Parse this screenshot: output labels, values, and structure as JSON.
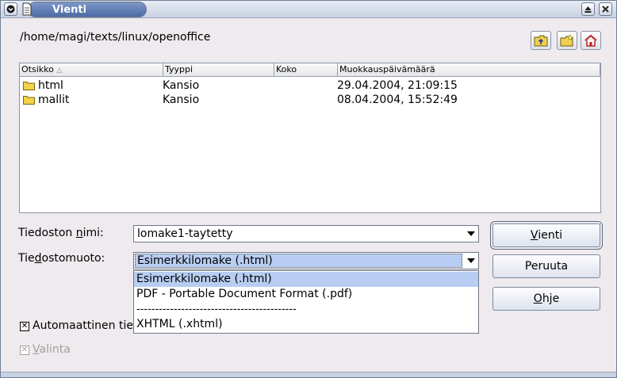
{
  "window": {
    "title": "Vienti"
  },
  "path": "/home/magi/texts/linux/openoffice",
  "file_list": {
    "columns": [
      "Otsikko",
      "Tyyppi",
      "Koko",
      "Muokkauspäivämäärä"
    ],
    "rows": [
      {
        "name": "html",
        "type": "Kansio",
        "size": "",
        "modified": "29.04.2004, 21:09:15"
      },
      {
        "name": "mallit",
        "type": "Kansio",
        "size": "",
        "modified": "08.04.2004, 15:52:49"
      }
    ]
  },
  "form": {
    "filename_label_pre": "Tiedoston ",
    "filename_label_u": "n",
    "filename_label_post": "imi:",
    "filename_value": "lomake1-taytetty",
    "filetype_label_pre": "Tie",
    "filetype_label_u": "d",
    "filetype_label_post": "ostomuoto:",
    "filetype_value": "Esimerkkilomake (.html)",
    "filetype_options": [
      "Esimerkkilomake (.html)",
      "PDF - Portable Document Format (.pdf)",
      "-------------------------------------------",
      "XHTML (.xhtml)"
    ],
    "auto_ext_label": "Automaattinen tie",
    "selection_label_u": "V",
    "selection_label_post": "alinta"
  },
  "buttons": {
    "export_u": "V",
    "export_post": "ienti",
    "cancel": "Peruuta",
    "help_u": "O",
    "help_post": "hje"
  },
  "colors": {
    "selection": "#b8cdf2",
    "title_bar": "#5a75ae"
  }
}
